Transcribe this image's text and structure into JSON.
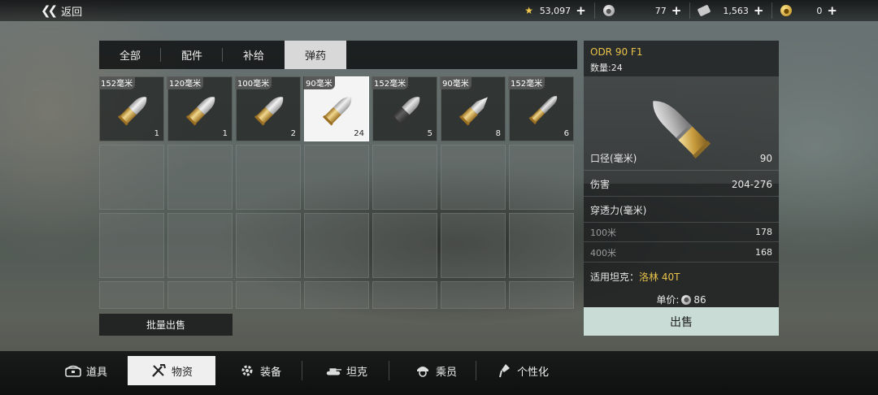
{
  "topbar": {
    "back_label": "返回",
    "currencies": [
      {
        "icon": "star-icon",
        "value": "53,097"
      },
      {
        "icon": "silver-coin-icon",
        "value": "77"
      },
      {
        "icon": "banknote-icon",
        "value": "1,563"
      },
      {
        "icon": "gold-coin-icon",
        "value": "0"
      }
    ]
  },
  "tabs": [
    {
      "label": "全部",
      "active": false
    },
    {
      "label": "配件",
      "active": false
    },
    {
      "label": "补给",
      "active": false
    },
    {
      "label": "弹药",
      "active": true
    }
  ],
  "items": [
    {
      "caliber": "152毫米",
      "count": "1",
      "shell": "gold"
    },
    {
      "caliber": "120毫米",
      "count": "1",
      "shell": "gold"
    },
    {
      "caliber": "100毫米",
      "count": "2",
      "shell": "gold"
    },
    {
      "caliber": "90毫米",
      "count": "24",
      "shell": "gold",
      "selected": true
    },
    {
      "caliber": "152毫米",
      "count": "5",
      "shell": "silver"
    },
    {
      "caliber": "90毫米",
      "count": "8",
      "shell": "pointed"
    },
    {
      "caliber": "152毫米",
      "count": "6",
      "shell": "long"
    }
  ],
  "bulk_sell_label": "批量出售",
  "detail": {
    "name": "ODR 90 F1",
    "quantity": "数量:24",
    "caliber_label": "口径(毫米)",
    "caliber_value": "90",
    "damage_label": "伤害",
    "damage_value": "204-276",
    "penetration_label": "穿透力(毫米)",
    "pen_100_label": "100米",
    "pen_100_value": "178",
    "pen_400_label": "400米",
    "pen_400_value": "168",
    "tanks_label": "适用坦克：",
    "tanks_value": "洛林 40T",
    "price_label": "单价:",
    "price_value": "86",
    "sell_label": "出售"
  },
  "bottomnav": [
    {
      "label": "道具",
      "icon": "chest-icon",
      "active": false
    },
    {
      "label": "物资",
      "icon": "tools-icon",
      "active": true
    },
    {
      "label": "装备",
      "icon": "gear-icon",
      "active": false
    },
    {
      "label": "坦克",
      "icon": "tank-icon",
      "active": false
    },
    {
      "label": "乘员",
      "icon": "crew-icon",
      "active": false
    },
    {
      "label": "个性化",
      "icon": "paint-brush-icon",
      "active": false
    }
  ],
  "colors": {
    "accent": "#e9c24a",
    "sell_button": "#c9dcd6"
  }
}
